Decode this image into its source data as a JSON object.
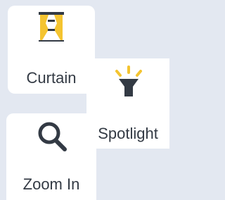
{
  "tiles": {
    "curtain": {
      "label": "Curtain",
      "icon": "curtain-icon"
    },
    "spotlight": {
      "label": "Spotlight",
      "icon": "spotlight-icon"
    },
    "zoom_in": {
      "label": "Zoom In",
      "icon": "magnifier-icon"
    }
  },
  "colors": {
    "background": "#e3e8f1",
    "tile": "#ffffff",
    "accent": "#f4c430",
    "icon_dark": "#333a44",
    "text": "#333a44"
  }
}
